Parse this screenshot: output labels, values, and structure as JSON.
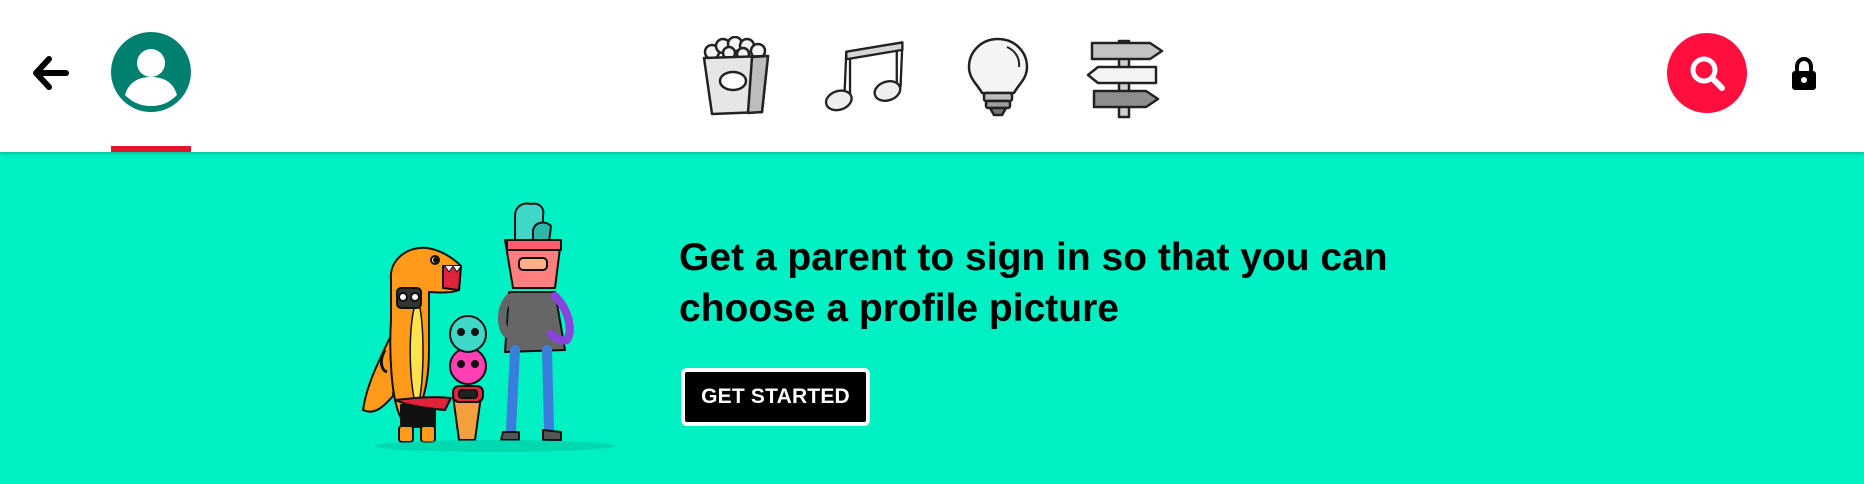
{
  "header": {
    "back_icon": "arrow-left-icon",
    "profile_icon": "account-circle-icon",
    "colors": {
      "avatar": "#00806E",
      "active_tab_underline": "#E4162B",
      "search": "#FF0F3E"
    },
    "categories": [
      {
        "icon": "popcorn-icon",
        "label": "shows"
      },
      {
        "icon": "music-notes-icon",
        "label": "music"
      },
      {
        "icon": "light-bulb-icon",
        "label": "learning"
      },
      {
        "icon": "signpost-icon",
        "label": "explore"
      }
    ],
    "search_icon": "search-icon",
    "lock_icon": "lock-icon"
  },
  "banner": {
    "background": "#00F0C4",
    "headline": "Get a parent to sign in so that you can choose a profile picture",
    "cta_label": "GET STARTED"
  }
}
